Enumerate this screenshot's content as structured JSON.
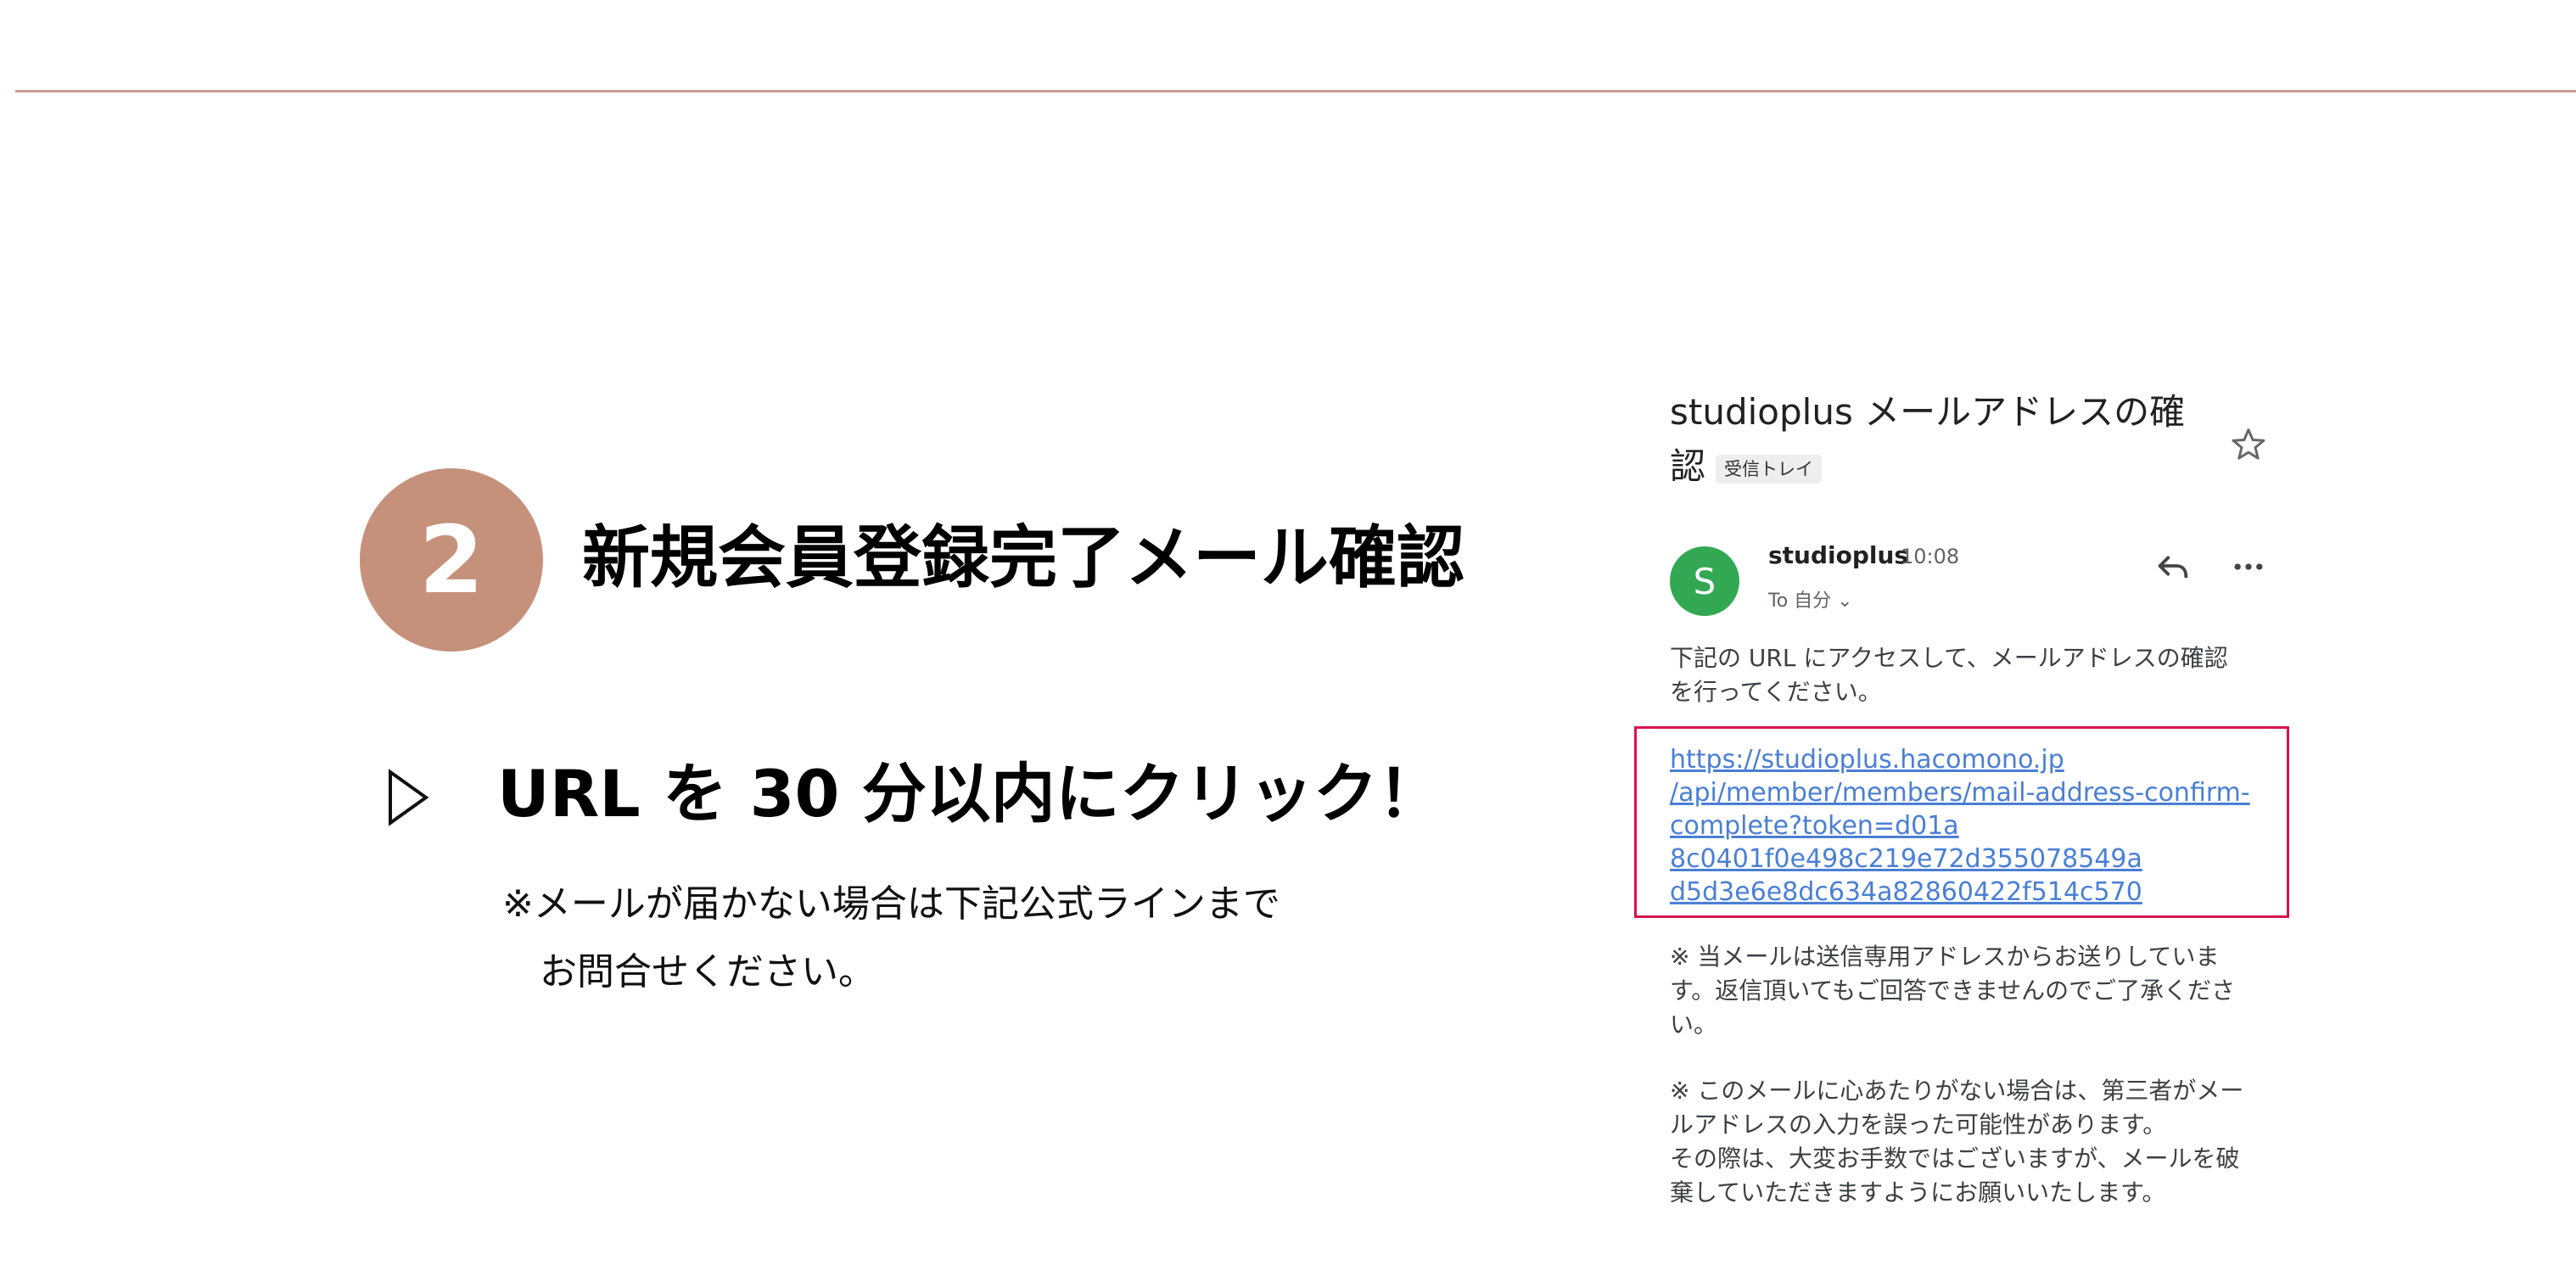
{
  "step": {
    "number": "2",
    "title": "新規会員登録完了メール確認"
  },
  "instruction": {
    "text": "URL を 30 分以内にクリック！",
    "note_line1": "※メールが届かない場合は下記公式ラインまで",
    "note_line2": "お問合せください。"
  },
  "email": {
    "subject_line1": "studioplus メールアドレスの確",
    "subject_line2": "認",
    "inbox_label": "受信トレイ",
    "sender_initial": "S",
    "sender_name": "studioplus",
    "time": "10:08",
    "recipient": "To 自分 ⌄",
    "body_line1": "下記の URL にアクセスして、メールアドレスの確認",
    "body_line2": "を行ってください。",
    "link_lines": [
      "https://studioplus.hacomono.jp",
      "/api/member/members/mail-address-confirm-",
      "complete?token=d01a",
      "8c0401f0e498c219e72d355078549a",
      "d5d3e6e8dc634a82860422f514c570"
    ],
    "note_a_lines": [
      "※ 当メールは送信専用アドレスからお送りしていま",
      "す。返信頂いてもご回答できませんのでご了承くださ",
      "い。"
    ],
    "note_b_lines": [
      "※ このメールに心あたりがない場合は、第三者がメー",
      "ルアドレスの入力を誤った可能性があります。",
      "その際は、大変お手数ではございますが、メールを破",
      "棄していただきますようにお願いいたします。"
    ]
  },
  "colors": {
    "accent": "#c5917b",
    "rule": "#c99b93",
    "avatar": "#33a852",
    "link": "#4a7fd4",
    "highlight_border": "#d8134e"
  },
  "icons": {
    "bullet": "triangle-outline-icon",
    "star": "star-outline-icon",
    "reply": "reply-arrow-icon",
    "more": "more-dots-icon"
  }
}
